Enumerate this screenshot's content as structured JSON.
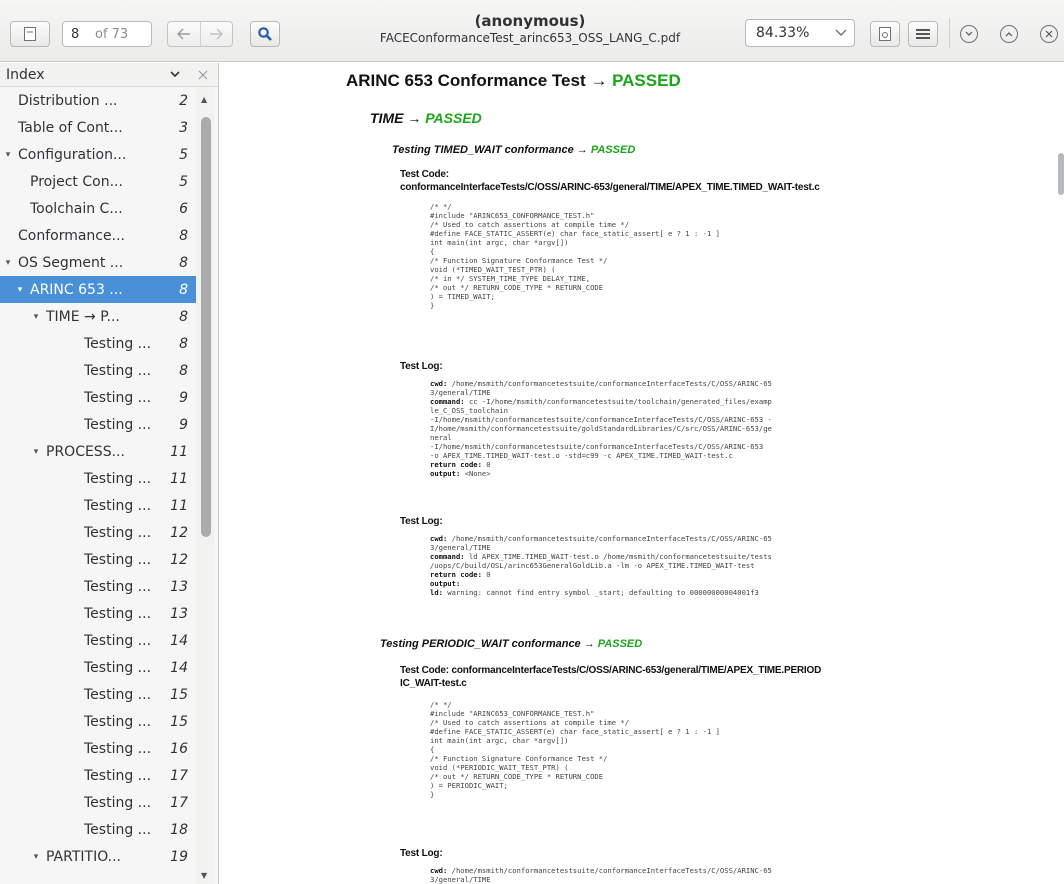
{
  "toolbar": {
    "page_current": "8",
    "page_total": "of 73",
    "title": "(anonymous)",
    "filename": "FACEConformanceTest_arinc653_OSS_LANG_C.pdf",
    "zoom": "84.33%"
  },
  "sidebar": {
    "header": "Index",
    "items": [
      {
        "label": "Distribution ...",
        "page": "2",
        "indent": 0,
        "twisty": ""
      },
      {
        "label": "Table of Cont...",
        "page": "3",
        "indent": 0,
        "twisty": ""
      },
      {
        "label": "Configuration...",
        "page": "5",
        "indent": 0,
        "twisty": "▾"
      },
      {
        "label": "Project Con...",
        "page": "5",
        "indent": 1,
        "twisty": ""
      },
      {
        "label": "Toolchain C...",
        "page": "6",
        "indent": 1,
        "twisty": ""
      },
      {
        "label": "Conformance...",
        "page": "8",
        "indent": 0,
        "twisty": ""
      },
      {
        "label": "OS Segment ...",
        "page": "8",
        "indent": 0,
        "twisty": "▾"
      },
      {
        "label": "ARINC 653 ...",
        "page": "8",
        "indent": 1,
        "twisty": "▾",
        "selected": true
      },
      {
        "label": "TIME → P...",
        "page": "8",
        "indent": 2,
        "twisty": "▾"
      },
      {
        "label": "Testing ...",
        "page": "8",
        "indent": 3,
        "twisty": ""
      },
      {
        "label": "Testing ...",
        "page": "8",
        "indent": 3,
        "twisty": ""
      },
      {
        "label": "Testing ...",
        "page": "9",
        "indent": 3,
        "twisty": ""
      },
      {
        "label": "Testing ...",
        "page": "9",
        "indent": 3,
        "twisty": ""
      },
      {
        "label": "PROCESS...",
        "page": "11",
        "indent": 2,
        "twisty": "▾"
      },
      {
        "label": "Testing ...",
        "page": "11",
        "indent": 3,
        "twisty": ""
      },
      {
        "label": "Testing ...",
        "page": "11",
        "indent": 3,
        "twisty": ""
      },
      {
        "label": "Testing ...",
        "page": "12",
        "indent": 3,
        "twisty": ""
      },
      {
        "label": "Testing ...",
        "page": "12",
        "indent": 3,
        "twisty": ""
      },
      {
        "label": "Testing ...",
        "page": "13",
        "indent": 3,
        "twisty": ""
      },
      {
        "label": "Testing ...",
        "page": "13",
        "indent": 3,
        "twisty": ""
      },
      {
        "label": "Testing ...",
        "page": "14",
        "indent": 3,
        "twisty": ""
      },
      {
        "label": "Testing ...",
        "page": "14",
        "indent": 3,
        "twisty": ""
      },
      {
        "label": "Testing ...",
        "page": "15",
        "indent": 3,
        "twisty": ""
      },
      {
        "label": "Testing ...",
        "page": "15",
        "indent": 3,
        "twisty": ""
      },
      {
        "label": "Testing ...",
        "page": "16",
        "indent": 3,
        "twisty": ""
      },
      {
        "label": "Testing ...",
        "page": "17",
        "indent": 3,
        "twisty": ""
      },
      {
        "label": "Testing ...",
        "page": "17",
        "indent": 3,
        "twisty": ""
      },
      {
        "label": "Testing ...",
        "page": "18",
        "indent": 3,
        "twisty": ""
      },
      {
        "label": "PARTITIO...",
        "page": "19",
        "indent": 2,
        "twisty": "▾"
      }
    ]
  },
  "doc": {
    "h1_text": "ARINC 653 Conformance Test → ",
    "h1_status": "PASSED",
    "h2_text": "TIME → ",
    "h2_status": "PASSED",
    "sec1": {
      "heading": "Testing TIMED_WAIT conformance → ",
      "status": "PASSED",
      "code_label": "Test Code:",
      "code_path": "conformanceInterfaceTests/C/OSS/ARINC-653/general/TIME/APEX_TIME.TIMED_WAIT-test.c",
      "code": "/* */\n#include \"ARINC653_CONFORMANCE_TEST.h\"\n/* Used to catch assertions at compile time */\n#define FACE_STATIC_ASSERT(e) char face_static_assert[ e ? 1 : -1 ]\nint main(int argc, char *argv[])\n{\n/* Function Signature Conformance Test */\nvoid (*TIMED_WAIT_TEST_PTR) (\n/* in */ SYSTEM_TIME_TYPE DELAY_TIME,\n/* out */ RETURN_CODE_TYPE * RETURN_CODE\n) = TIMED_WAIT;\n}",
      "log1_label": "Test Log:",
      "log1": {
        "cwd_k": "cwd:",
        "cwd": " /home/msmith/conformancetestsuite/conformanceInterfaceTests/C/OSS/ARINC-65\n3/general/TIME",
        "cmd_k": "command:",
        "cmd": " cc -I/home/msmith/conformancetestsuite/toolchain/generated_files/examp\nle_C_OSS_toolchain\n-I/home/msmith/conformancetestsuite/conformanceInterfaceTests/C/OSS/ARINC-653 -\nI/home/msmith/conformancetestsuite/goldStandardLibraries/C/src/OSS/ARINC-653/ge\nneral\n-I/home/msmith/conformancetestsuite/conformanceInterfaceTests/C/OSS/ARINC-653\n-o APEX_TIME.TIMED_WAIT-test.o -std=c99 -c APEX_TIME.TIMED_WAIT-test.c",
        "rc_k": "return code:",
        "rc": " 0",
        "out_k": "output:",
        "out": " <None>"
      },
      "log2_label": "Test Log:",
      "log2": {
        "cwd_k": "cwd:",
        "cwd": " /home/msmith/conformancetestsuite/conformanceInterfaceTests/C/OSS/ARINC-65\n3/general/TIME",
        "cmd_k": "command:",
        "cmd": " ld APEX_TIME.TIMED_WAIT-test.o /home/msmith/conformancetestsuite/tests\n/uops/C/build/OSL/arinc653GeneralGoldLib.a -lm -o APEX_TIME.TIMED_WAIT-test",
        "rc_k": "return code:",
        "rc": " 0",
        "out_k": "output:",
        "out": "",
        "ld_k": "ld:",
        "ld": " warning: cannot find entry symbol _start; defaulting to 00000000004001f3"
      }
    },
    "sec2": {
      "heading": "Testing PERIODIC_WAIT conformance → ",
      "status": "PASSED",
      "code_label": "Test Code: conformanceInterfaceTests/C/OSS/ARINC-653/general/TIME/APEX_TIME.PERIOD\nIC_WAIT-test.c",
      "code": "/* */\n#include \"ARINC653_CONFORMANCE_TEST.h\"\n/* Used to catch assertions at compile time */\n#define FACE_STATIC_ASSERT(e) char face_static_assert[ e ? 1 : -1 ]\nint main(int argc, char *argv[])\n{\n/* Function Signature Conformance Test */\nvoid (*PERIODIC_WAIT_TEST_PTR) (\n/* out */ RETURN_CODE_TYPE * RETURN_CODE\n) = PERIODIC_WAIT;\n}",
      "log_label": "Test Log:",
      "log": {
        "cwd_k": "cwd:",
        "cwd": " /home/msmith/conformancetestsuite/conformanceInterfaceTests/C/OSS/ARINC-65\n3/general/TIME"
      }
    }
  }
}
